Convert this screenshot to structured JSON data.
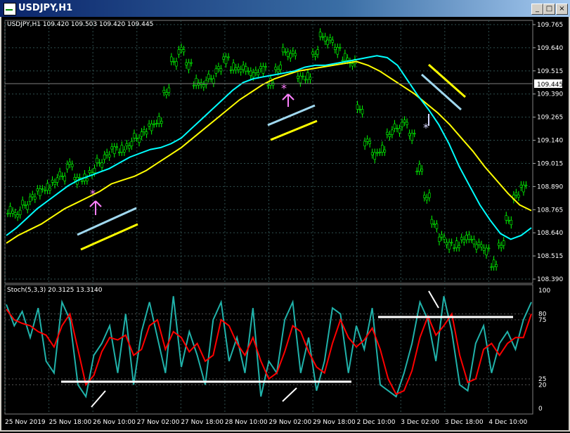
{
  "window": {
    "title": "USDJPY,H1",
    "buttons": {
      "minimize": "_",
      "maximize": "□",
      "close": "×"
    }
  },
  "main_panel": {
    "header": "USDJPY,H1  109.420 109.503 109.420 109.445",
    "price_labels": [
      "109.765",
      "109.640",
      "109.515",
      "109.390",
      "109.265",
      "109.140",
      "109.015",
      "108.890",
      "108.765",
      "108.640",
      "108.515",
      "108.390"
    ],
    "current_price": "109.445"
  },
  "sub_panel": {
    "header": "Stoch(5,3,3) 20.3125 13.3140",
    "levels": [
      "100",
      "80",
      "75",
      "25",
      "20",
      "0"
    ]
  },
  "time_labels": [
    "25 Nov 2019",
    "25 Nov 18:00",
    "26 Nov 10:00",
    "27 Nov 02:00",
    "27 Nov 18:00",
    "28 Nov 10:00",
    "29 Nov 02:00",
    "29 Nov 18:00",
    "2 Dec 10:00",
    "3 Dec 02:00",
    "3 Dec 18:00",
    "4 Dec 10:00"
  ],
  "colors": {
    "candles": "#00ff00",
    "ma_fast": "#00ffff",
    "ma_slow": "#ffff00",
    "stoch_main": "#20b2aa",
    "stoch_signal": "#ff0000",
    "grid": "#2f4f4f",
    "marker_pink": "#ff80ff",
    "arrow_lightblue": "#a0d8ef",
    "arrow_yellow": "#ffff00"
  },
  "chart_data": [
    {
      "type": "candlestick",
      "title": "USDJPY,H1",
      "ylim": [
        108.39,
        109.765
      ],
      "series": [
        {
          "name": "price",
          "values": [
            108.78,
            108.76,
            108.8,
            108.83,
            108.86,
            108.9,
            108.93,
            108.95,
            109.0,
            108.92,
            108.95,
            108.98,
            109.02,
            109.05,
            109.08,
            109.1,
            109.12,
            109.15,
            109.17,
            109.2,
            109.25,
            109.4,
            109.55,
            109.6,
            109.52,
            109.45,
            109.44,
            109.46,
            109.5,
            109.55,
            109.53,
            109.52,
            109.5,
            109.48,
            109.5,
            109.45,
            109.52,
            109.6,
            109.58,
            109.45,
            109.48,
            109.6,
            109.68,
            109.65,
            109.6,
            109.58,
            109.55,
            109.3,
            109.12,
            109.05,
            109.1,
            109.18,
            109.2,
            109.22,
            109.15,
            109.0,
            108.85,
            108.7,
            108.62,
            108.58,
            108.6,
            108.63,
            108.62,
            108.58,
            108.55,
            108.5,
            108.6,
            108.72,
            108.84,
            108.88
          ]
        },
        {
          "name": "ma_fast",
          "values": [
            108.64,
            108.68,
            108.73,
            108.78,
            108.82,
            108.86,
            108.9,
            108.93,
            108.95,
            108.97,
            108.99,
            109.02,
            109.05,
            109.07,
            109.09,
            109.1,
            109.12,
            109.15,
            109.2,
            109.25,
            109.3,
            109.35,
            109.4,
            109.44,
            109.46,
            109.47,
            109.48,
            109.49,
            109.5,
            109.52,
            109.53,
            109.53,
            109.54,
            109.55,
            109.56,
            109.57,
            109.58,
            109.57,
            109.53,
            109.45,
            109.37,
            109.3,
            109.22,
            109.12,
            109.0,
            108.9,
            108.8,
            108.72,
            108.65,
            108.62,
            108.64,
            108.68
          ]
        },
        {
          "name": "ma_slow",
          "values": [
            108.6,
            108.64,
            108.67,
            108.7,
            108.74,
            108.78,
            108.81,
            108.84,
            108.87,
            108.91,
            108.93,
            108.95,
            108.98,
            109.02,
            109.06,
            109.1,
            109.15,
            109.2,
            109.25,
            109.3,
            109.35,
            109.39,
            109.43,
            109.46,
            109.48,
            109.5,
            109.51,
            109.52,
            109.53,
            109.54,
            109.55,
            109.53,
            109.5,
            109.46,
            109.42,
            109.38,
            109.33,
            109.28,
            109.22,
            109.15,
            109.08,
            109.0,
            108.93,
            108.86,
            108.8,
            108.77
          ]
        }
      ]
    },
    {
      "type": "line",
      "title": "Stoch(5,3,3) 20.3125 13.3140",
      "ylim": [
        0,
        100
      ],
      "series": [
        {
          "name": "main",
          "values": [
            88,
            70,
            82,
            60,
            85,
            40,
            30,
            90,
            75,
            20,
            10,
            45,
            55,
            70,
            30,
            80,
            20,
            65,
            90,
            60,
            30,
            95,
            35,
            65,
            45,
            20,
            75,
            90,
            40,
            60,
            30,
            85,
            10,
            40,
            30,
            75,
            90,
            30,
            60,
            15,
            40,
            85,
            80,
            30,
            70,
            50,
            85,
            20,
            15,
            10,
            30,
            55,
            90,
            75,
            40,
            95,
            65,
            20,
            15,
            55,
            70,
            30,
            55,
            65,
            50,
            75,
            90
          ]
        },
        {
          "name": "signal",
          "values": [
            84,
            75,
            72,
            70,
            65,
            62,
            52,
            70,
            80,
            50,
            20,
            28,
            48,
            60,
            58,
            62,
            45,
            50,
            70,
            75,
            50,
            65,
            60,
            48,
            55,
            40,
            45,
            75,
            70,
            55,
            45,
            60,
            40,
            25,
            30,
            48,
            70,
            65,
            48,
            35,
            30,
            55,
            75,
            60,
            52,
            58,
            68,
            50,
            25,
            12,
            15,
            32,
            60,
            78,
            62,
            70,
            80,
            45,
            22,
            25,
            50,
            55,
            45,
            55,
            60,
            60,
            80
          ]
        }
      ],
      "levels": [
        100,
        80,
        75,
        25,
        20,
        0
      ]
    }
  ]
}
